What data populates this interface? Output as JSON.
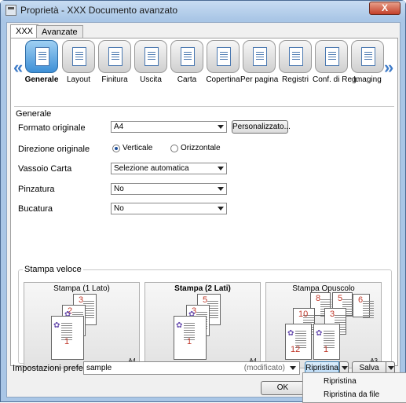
{
  "window": {
    "title": "Proprietà - XXX Documento avanzato",
    "close_label": "X"
  },
  "tabs": [
    {
      "label": "XXX"
    },
    {
      "label": "Avanzate"
    }
  ],
  "iconbar": {
    "items": [
      {
        "label": "Generale",
        "icon": "general-icon",
        "selected": true
      },
      {
        "label": "Layout",
        "icon": "layout-icon"
      },
      {
        "label": "Finitura",
        "icon": "finishing-icon"
      },
      {
        "label": "Uscita",
        "icon": "output-icon"
      },
      {
        "label": "Carta",
        "icon": "paper-icon"
      },
      {
        "label": "Copertina",
        "icon": "cover-icon"
      },
      {
        "label": "Per pagina",
        "icon": "per-page-icon"
      },
      {
        "label": "Registri",
        "icon": "registers-icon"
      },
      {
        "label": "Conf. di Reg.",
        "icon": "register-config-icon"
      },
      {
        "label": "Imaging",
        "icon": "imaging-icon"
      }
    ],
    "scroll_left": "«",
    "scroll_right": "»"
  },
  "general": {
    "section_title": "Generale",
    "formato_originale": {
      "label": "Formato originale",
      "value": "A4",
      "button": "Personalizzato..."
    },
    "direzione_originale": {
      "label": "Direzione originale",
      "options": [
        "Verticale",
        "Orizzontale"
      ],
      "selected": "Verticale"
    },
    "vassoio_carta": {
      "label": "Vassoio Carta",
      "value": "Selezione automatica"
    },
    "pinzatura": {
      "label": "Pinzatura",
      "value": "No"
    },
    "bucatura": {
      "label": "Bucatura",
      "value": "No"
    }
  },
  "stampa_veloce": {
    "title": "Stampa veloce",
    "presets": [
      {
        "title": "Stampa (1 Lato)",
        "size": "A4",
        "pages": [
          "3",
          "2",
          "1"
        ]
      },
      {
        "title": "Stampa (2 Lati)",
        "size": "A4",
        "pages": [
          "5",
          "3",
          "1"
        ]
      },
      {
        "title": "Stampa Opuscolo",
        "size": "A3",
        "pages": [
          "8",
          "5",
          "10",
          "3",
          "12",
          "1",
          "6"
        ]
      }
    ]
  },
  "footer": {
    "fav_label": "Impostazioni preferite",
    "fav_value": "sample",
    "fav_status": "(modificato)",
    "restore_button": "Ripristina",
    "save_button": "Salva",
    "ok_button": "OK"
  },
  "dropdown_menu": {
    "items": [
      "Ripristina",
      "Ripristina da file"
    ]
  }
}
